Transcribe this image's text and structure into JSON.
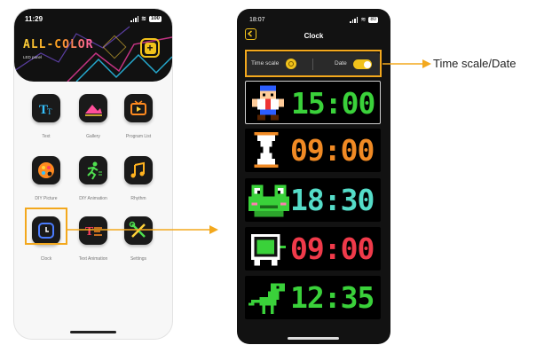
{
  "left_phone": {
    "status": {
      "time": "11:29",
      "battery": "100"
    },
    "app_title": "ALL-COLOR",
    "app_subtitle": "LED panel",
    "tiles": [
      {
        "label": "Text"
      },
      {
        "label": "Gallery"
      },
      {
        "label": "Program List"
      },
      {
        "label": "DIY Picture"
      },
      {
        "label": "DIY Animation"
      },
      {
        "label": "Rhythm"
      },
      {
        "label": "Clock"
      },
      {
        "label": "Text Animation"
      },
      {
        "label": "Settings"
      }
    ]
  },
  "right_phone": {
    "status": {
      "time": "18:07",
      "battery": "80"
    },
    "title": "Clock",
    "settings": {
      "time_scale_label": "Time scale",
      "date_label": "Date",
      "date_enabled": true
    },
    "clocks": [
      {
        "time": "15:00",
        "color": "#3ad13a",
        "sprite": "pixel-character-icon",
        "selected": true
      },
      {
        "time": "09:00",
        "color": "#f08a24",
        "sprite": "hourglass-icon",
        "selected": false
      },
      {
        "time": "18:30",
        "color": "#55dcc8",
        "sprite": "frog-icon",
        "selected": false
      },
      {
        "time": "09:00",
        "color": "#f03a4a",
        "sprite": "pixel-tv-icon",
        "selected": false
      },
      {
        "time": "12:35",
        "color": "#3ad13a",
        "sprite": "dinosaur-icon",
        "selected": false
      }
    ]
  },
  "annotation": {
    "label": "Time scale/Date",
    "accent": "#f3a81d"
  }
}
